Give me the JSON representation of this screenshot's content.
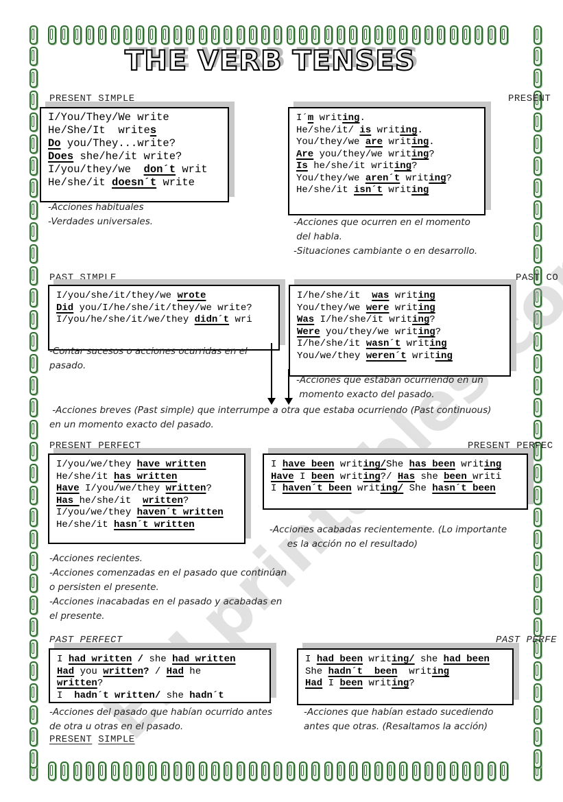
{
  "title": "THE VERB TENSES",
  "watermark": "ESLprintables.com",
  "sections": {
    "present_simple": {
      "header": "PRESENT SIMPLE",
      "lines": [
        [
          {
            "t": "I/You/They/We write"
          }
        ],
        [
          {
            "t": "He/She/It  write"
          },
          {
            "t": "s",
            "b": 1,
            "u": 1
          }
        ],
        [
          {
            "t": "Do",
            "b": 1,
            "u": 1
          },
          {
            "t": " you/They...write?"
          }
        ],
        [
          {
            "t": "Does",
            "b": 1,
            "u": 1
          },
          {
            "t": " she/he/it write?"
          }
        ],
        [
          {
            "t": "I/you/they/we  "
          },
          {
            "t": "don´t",
            "b": 1,
            "u": 1
          },
          {
            "t": " writ"
          }
        ],
        [
          {
            "t": "He/she/it "
          },
          {
            "t": "doesn´t",
            "b": 1,
            "u": 1
          },
          {
            "t": " write"
          }
        ]
      ],
      "notes": [
        "-Acciones habituales",
        "-Verdades universales."
      ]
    },
    "present_continuous": {
      "header": "PRESENT",
      "lines": [
        [
          {
            "t": "I´"
          },
          {
            "t": "m",
            "b": 1,
            "u": 1
          },
          {
            "t": " writ"
          },
          {
            "t": "ing",
            "b": 1,
            "u": 1
          },
          {
            "t": "."
          }
        ],
        [
          {
            "t": "He/she/it/ "
          },
          {
            "t": "is",
            "b": 1,
            "u": 1
          },
          {
            "t": " writ"
          },
          {
            "t": "ing",
            "b": 1,
            "u": 1
          },
          {
            "t": "."
          }
        ],
        [
          {
            "t": "You/they/we "
          },
          {
            "t": "are",
            "b": 1,
            "u": 1
          },
          {
            "t": " writ"
          },
          {
            "t": "ing",
            "b": 1,
            "u": 1
          },
          {
            "t": "."
          }
        ],
        [
          {
            "t": "Are",
            "b": 1,
            "u": 1
          },
          {
            "t": " you/they/we writ"
          },
          {
            "t": "ing",
            "b": 1,
            "u": 1
          },
          {
            "t": "?"
          }
        ],
        [
          {
            "t": "Is",
            "b": 1,
            "u": 1
          },
          {
            "t": " he/she/it writ"
          },
          {
            "t": "ing",
            "b": 1,
            "u": 1
          },
          {
            "t": "?"
          }
        ],
        [
          {
            "t": "You/they/we "
          },
          {
            "t": "aren´t",
            "b": 1,
            "u": 1
          },
          {
            "t": " writ"
          },
          {
            "t": "ing",
            "b": 1,
            "u": 1
          },
          {
            "t": "?"
          }
        ],
        [
          {
            "t": "He/she/it "
          },
          {
            "t": "isn´t",
            "b": 1,
            "u": 1
          },
          {
            "t": " writ"
          },
          {
            "t": "ing",
            "b": 1,
            "u": 1
          }
        ]
      ],
      "notes": [
        "-Acciones que ocurren en el momento",
        " del habla.",
        "-Situaciones cambiante o en desarrollo."
      ]
    },
    "past_simple": {
      "header": "PAST SIMPLE",
      "lines": [
        [
          {
            "t": "I/you/she/it/they/we "
          },
          {
            "t": "wrote",
            "b": 1,
            "u": 1
          }
        ],
        [
          {
            "t": "Did",
            "b": 1,
            "u": 1
          },
          {
            "t": " you/I/he/she/it/they/we write?"
          }
        ],
        [
          {
            "t": "I/you/he/she/it/we/they "
          },
          {
            "t": "didn´t",
            "b": 1,
            "u": 1
          },
          {
            "t": " wri"
          }
        ]
      ],
      "notes": [
        "-Contar sucesos o acciones ocurridas en el",
        "pasado."
      ]
    },
    "past_continuous": {
      "header": "PAST CO",
      "lines": [
        [
          {
            "t": "I/he/she/it  "
          },
          {
            "t": "was",
            "b": 1,
            "u": 1
          },
          {
            "t": " writ"
          },
          {
            "t": "ing",
            "b": 1,
            "u": 1
          }
        ],
        [
          {
            "t": "You/they/we "
          },
          {
            "t": "were",
            "b": 1,
            "u": 1
          },
          {
            "t": " writ"
          },
          {
            "t": "ing",
            "b": 1,
            "u": 1
          }
        ],
        [
          {
            "t": "Was",
            "b": 1,
            "u": 1
          },
          {
            "t": " I/he/she/it writ"
          },
          {
            "t": "ing",
            "b": 1,
            "u": 1
          },
          {
            "t": "?"
          }
        ],
        [
          {
            "t": "Were",
            "b": 1,
            "u": 1
          },
          {
            "t": " you/they/we writ"
          },
          {
            "t": "ing",
            "b": 1,
            "u": 1
          },
          {
            "t": "?"
          }
        ],
        [
          {
            "t": "I/he/she/it "
          },
          {
            "t": "wasn´t",
            "b": 1,
            "u": 1
          },
          {
            "t": " writ"
          },
          {
            "t": "ing",
            "b": 1,
            "u": 1
          }
        ],
        [
          {
            "t": "You/we/they "
          },
          {
            "t": "weren´t",
            "b": 1,
            "u": 1
          },
          {
            "t": " writ"
          },
          {
            "t": "ing",
            "b": 1,
            "u": 1
          }
        ]
      ],
      "notes": [
        "-Acciones que estaban ocurriendo en un",
        " momento exacto del pasado."
      ]
    },
    "interrupt_note": [
      " -Acciones breves (Past simple) que interrumpe a otra que estaba ocurriendo (Past continuous)",
      "en un momento exacto del pasado."
    ],
    "present_perfect": {
      "header": "PRESENT PERFECT",
      "lines": [
        [
          {
            "t": "I/you/we/they "
          },
          {
            "t": "have written",
            "b": 1,
            "u": 1
          }
        ],
        [
          {
            "t": "He/she/it "
          },
          {
            "t": "has written",
            "b": 1,
            "u": 1
          }
        ],
        [
          {
            "t": "Have",
            "b": 1,
            "u": 1
          },
          {
            "t": " I/you/we/they "
          },
          {
            "t": "written",
            "b": 1,
            "u": 1
          },
          {
            "t": "?"
          }
        ],
        [
          {
            "t": "Has ",
            "b": 1,
            "u": 1
          },
          {
            "t": "he/she/it  "
          },
          {
            "t": "written",
            "b": 1,
            "u": 1
          },
          {
            "t": "?"
          }
        ],
        [
          {
            "t": "I/you/we/they "
          },
          {
            "t": "haven´t written",
            "b": 1,
            "u": 1
          }
        ],
        [
          {
            "t": "He/she/it "
          },
          {
            "t": "hasn´t written",
            "b": 1,
            "u": 1
          }
        ]
      ],
      "notes": [
        "-Acciones recientes.",
        "-Acciones comenzadas en el pasado que continúan",
        "o persisten el presente.",
        "-Acciones inacabadas en el pasado y acabadas en",
        "el presente."
      ]
    },
    "present_perfect_continuous": {
      "header": "PRESENT PERFEC",
      "lines": [
        [
          {
            "t": "I "
          },
          {
            "t": "have been",
            "b": 1,
            "u": 1
          },
          {
            "t": " writ"
          },
          {
            "t": "ing/",
            "b": 1,
            "u": 1
          },
          {
            "t": "She "
          },
          {
            "t": "has been",
            "b": 1,
            "u": 1
          },
          {
            "t": " writ"
          },
          {
            "t": "ing",
            "b": 1,
            "u": 1
          }
        ],
        [
          {
            "t": "Have",
            "b": 1,
            "u": 1
          },
          {
            "t": " I "
          },
          {
            "t": "been",
            "b": 1,
            "u": 1
          },
          {
            "t": " writ"
          },
          {
            "t": "ing",
            "b": 1,
            "u": 1
          },
          {
            "t": "?/ "
          },
          {
            "t": "Has",
            "b": 1,
            "u": 1
          },
          {
            "t": " she "
          },
          {
            "t": "been ",
            "b": 1,
            "u": 1
          },
          {
            "t": "writi"
          }
        ],
        [
          {
            "t": "I "
          },
          {
            "t": "haven´t been",
            "b": 1,
            "u": 1
          },
          {
            "t": " writ"
          },
          {
            "t": "ing/",
            "b": 1,
            "u": 1
          },
          {
            "t": " She "
          },
          {
            "t": "hasn´t been",
            "b": 1,
            "u": 1
          }
        ]
      ],
      "notes": [
        "-Acciones acabadas recientemente. (Lo importante",
        "      es la acción no el resultado)"
      ]
    },
    "past_perfect": {
      "header": "PAST PERFECT",
      "lines": [
        [
          {
            "t": "I "
          },
          {
            "t": "had written",
            "b": 1,
            "u": 1
          },
          {
            "t": " "
          },
          {
            "t": "/",
            "b": 1
          },
          {
            "t": " she "
          },
          {
            "t": "had written",
            "b": 1,
            "u": 1
          }
        ],
        [
          {
            "t": "Had",
            "b": 1,
            "u": 1
          },
          {
            "t": " you "
          },
          {
            "t": "written",
            "b": 1,
            "u": 1
          },
          {
            "t": "?",
            "b": 1
          },
          {
            "t": " / "
          },
          {
            "t": "Had",
            "b": 1,
            "u": 1
          },
          {
            "t": " he"
          }
        ],
        [
          {
            "t": "written",
            "b": 1,
            "u": 1
          },
          {
            "t": "?"
          }
        ],
        [
          {
            "t": "I  "
          },
          {
            "t": "hadn´t written/",
            "b": 1
          },
          {
            "t": " she "
          },
          {
            "t": "hadn´t",
            "b": 1
          }
        ]
      ],
      "notes": [
        "-Acciones del pasado que habían ocurrido antes",
        "de otra u otras en el pasado."
      ]
    },
    "past_perfect_continuous": {
      "header": "PAST PERFE",
      "lines": [
        [
          {
            "t": "I "
          },
          {
            "t": "had been",
            "b": 1,
            "u": 1
          },
          {
            "t": " writ"
          },
          {
            "t": "ing/",
            "b": 1,
            "u": 1
          },
          {
            "t": " she "
          },
          {
            "t": "had been",
            "b": 1,
            "u": 1
          }
        ],
        [
          {
            "t": "She "
          },
          {
            "t": "hadn´t  been",
            "b": 1,
            "u": 1
          },
          {
            "t": "  writ"
          },
          {
            "t": "ing",
            "b": 1,
            "u": 1
          }
        ],
        [
          {
            "t": "Had",
            "b": 1,
            "u": 1
          },
          {
            "t": " I "
          },
          {
            "t": "been",
            "b": 1,
            "u": 1
          },
          {
            "t": " writ"
          },
          {
            "t": "ing",
            "b": 1,
            "u": 1
          },
          {
            "t": "?"
          }
        ]
      ],
      "notes": [
        "-Acciones que habían estado sucediendo",
        "antes que otras. (Resaltamos la acción)"
      ]
    },
    "footer_link": [
      "PRESENT",
      "SIMPLE"
    ]
  },
  "border_color": "#2d6b2d"
}
